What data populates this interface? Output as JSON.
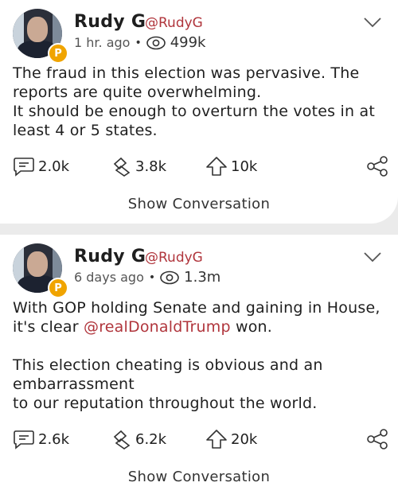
{
  "posts": [
    {
      "name": "Rudy G",
      "handle": "@RudyG",
      "time": "1 hr. ago",
      "views": "499k",
      "badge": "P",
      "body": "The fraud in this election was pervasive. The reports are quite overwhelming.\nIt should be enough to overturn the votes in at least 4 or 5 states.",
      "comments": "2.0k",
      "reposts": "3.8k",
      "upvotes": "10k",
      "show_conversation": "Show Conversation"
    },
    {
      "name": "Rudy G",
      "handle": "@RudyG",
      "time": "6 days ago",
      "views": "1.3m",
      "badge": "P",
      "body_before": "With GOP holding Senate and gaining in House, it's clear ",
      "mention": "@realDonaldTrump",
      "body_after": " won.\n\nThis election cheating is obvious and an embarrassment\nto our reputation throughout the world.",
      "comments": "2.6k",
      "reposts": "6.2k",
      "upvotes": "20k",
      "show_conversation": "Show Conversation"
    }
  ],
  "icons": {
    "comment": "comment-icon",
    "repost": "repost-icon",
    "upvote": "upvote-icon",
    "share": "share-icon",
    "views": "eye-icon",
    "menu": "chevron-down-icon"
  },
  "colors": {
    "handle": "#b0353c",
    "mention": "#b0353c",
    "badge": "#f0a400",
    "background": "#ebebeb",
    "card": "#ffffff"
  }
}
